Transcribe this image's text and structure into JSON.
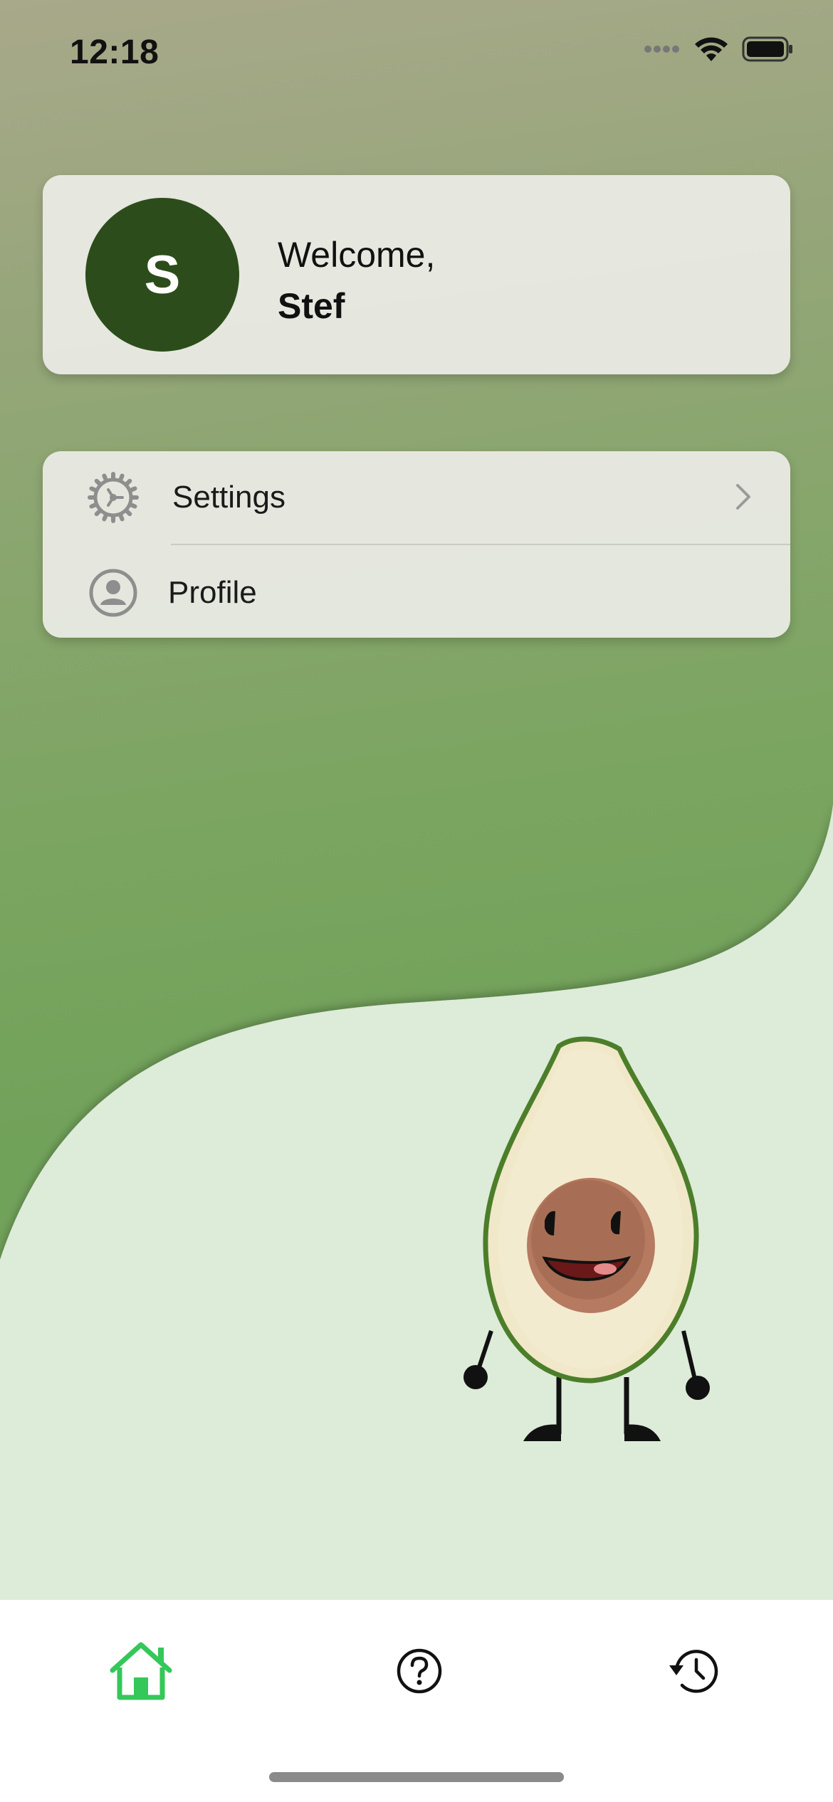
{
  "status_bar": {
    "time": "12:18"
  },
  "welcome": {
    "avatar_initial": "S",
    "greeting": "Welcome,",
    "name": "Stef"
  },
  "menu": {
    "items": [
      {
        "label": "Settings",
        "icon": "gear-icon",
        "has_chevron": true
      },
      {
        "label": "Profile",
        "icon": "person-circle-icon",
        "has_chevron": false
      }
    ]
  },
  "tab_bar": {
    "tabs": [
      {
        "icon": "home-icon",
        "active": true
      },
      {
        "icon": "question-circle-icon",
        "active": false
      },
      {
        "icon": "history-icon",
        "active": false
      }
    ],
    "active_color": "#34c759",
    "inactive_color": "#111111"
  },
  "colors": {
    "avatar_bg": "#2c4d1b",
    "wave_light": "#ddebd9",
    "wave_green": "#6fa158"
  }
}
